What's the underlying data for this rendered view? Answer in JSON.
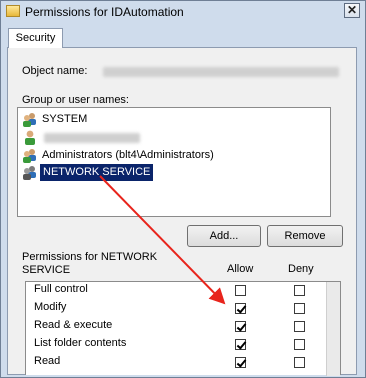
{
  "window": {
    "title": "Permissions for IDAutomation",
    "close_glyph": "✕"
  },
  "tabs": [
    {
      "label": "Security"
    }
  ],
  "object": {
    "label": "Object name:",
    "value_redacted": true
  },
  "groups": {
    "label": "Group or user names:",
    "items": [
      {
        "label": "SYSTEM",
        "icon": "users-icon"
      },
      {
        "label": "",
        "icon": "user-icon",
        "redacted": true
      },
      {
        "label": "Administrators (blt4\\Administrators)",
        "icon": "users-icon"
      },
      {
        "label": "NETWORK SERVICE",
        "icon": "users-icon",
        "selected": true
      }
    ]
  },
  "buttons": {
    "add": "Add...",
    "remove": "Remove"
  },
  "permissions": {
    "label": "Permissions for NETWORK SERVICE",
    "allow_header": "Allow",
    "deny_header": "Deny",
    "rows": [
      {
        "label": "Full control",
        "allow": false,
        "deny": false
      },
      {
        "label": "Modify",
        "allow": true,
        "deny": false
      },
      {
        "label": "Read & execute",
        "allow": true,
        "deny": false
      },
      {
        "label": "List folder contents",
        "allow": true,
        "deny": false
      },
      {
        "label": "Read",
        "allow": true,
        "deny": false
      }
    ]
  },
  "annotation": {
    "color": "#e8241c"
  }
}
